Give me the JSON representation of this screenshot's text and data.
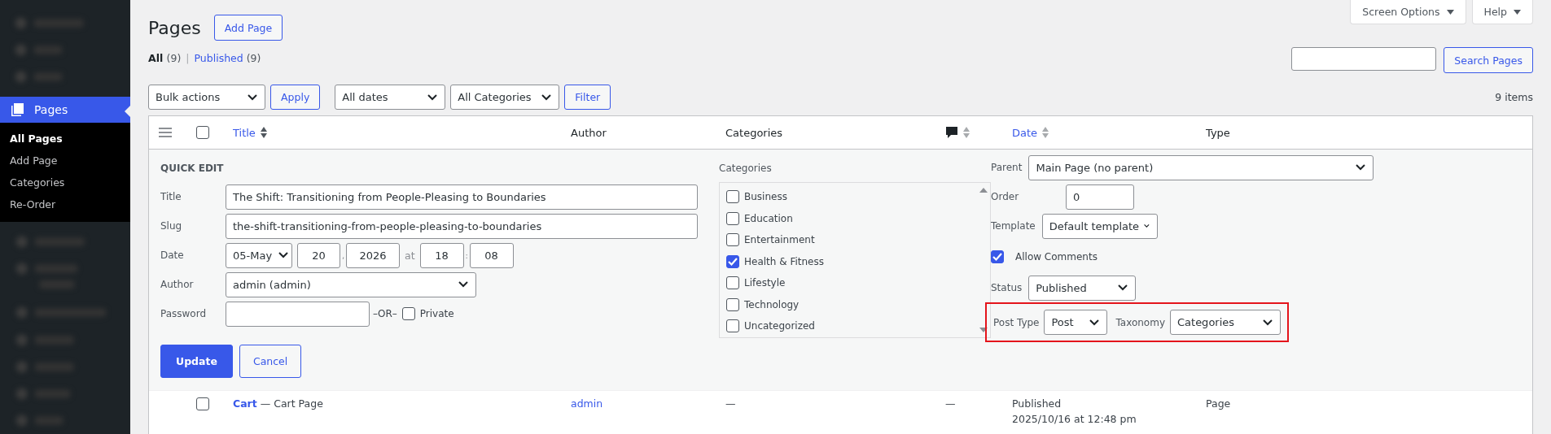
{
  "sidebar": {
    "active": {
      "label": "Pages",
      "selected": true
    },
    "submenu": [
      {
        "label": "All Pages",
        "selected": true
      },
      {
        "label": "Add Page",
        "selected": false
      },
      {
        "label": "Categories",
        "selected": false
      },
      {
        "label": "Re-Order",
        "selected": false
      }
    ]
  },
  "header": {
    "title": "Pages",
    "add_button": "Add Page",
    "screen_options": "Screen Options",
    "help": "Help"
  },
  "views_separator": "|",
  "views": [
    {
      "label": "All",
      "count": "(9)",
      "selected": true
    },
    {
      "label": "Published",
      "count": "(9)",
      "selected": false
    }
  ],
  "search": {
    "button": "Search Pages"
  },
  "toolbar": {
    "bulk_actions": "Bulk actions",
    "apply": "Apply",
    "dates": "All dates",
    "categories": "All Categories",
    "filter": "Filter",
    "items_count": "9 items"
  },
  "table": {
    "select_all": {
      "checked": false
    },
    "columns": [
      {
        "kind": "text",
        "label": "Title",
        "sortable": true
      },
      {
        "kind": "text",
        "label": "Author",
        "sortable": false
      },
      {
        "kind": "text",
        "label": "Categories",
        "sortable": false
      },
      {
        "kind": "comments",
        "sortable": true
      },
      {
        "kind": "text",
        "label": "Date",
        "sortable": true
      },
      {
        "kind": "text",
        "label": "Type",
        "sortable": false
      }
    ],
    "quick_edit": {
      "heading": "QUICK EDIT",
      "title": {
        "label": "Title",
        "value": "The Shift: Transitioning from People-Pleasing to Boundaries"
      },
      "slug": {
        "label": "Slug",
        "value": "the-shift-transitioning-from-people-pleasing-to-boundaries"
      },
      "date": {
        "label": "Date",
        "month": "05-May",
        "day": "20",
        "sep1": ",",
        "year": "2026",
        "at": "at",
        "hour": "18",
        "sep2": ":",
        "minute": "08"
      },
      "author": {
        "label": "Author",
        "value": "admin (admin)"
      },
      "password": {
        "label": "Password",
        "or": "–OR–",
        "private": {
          "label": "Private",
          "checked": false
        }
      },
      "categories_label": "Categories",
      "categories": [
        {
          "label": "Business",
          "checked": false
        },
        {
          "label": "Education",
          "checked": false
        },
        {
          "label": "Entertainment",
          "checked": false
        },
        {
          "label": "Health & Fitness",
          "checked": true
        },
        {
          "label": "Lifestyle",
          "checked": false
        },
        {
          "label": "Technology",
          "checked": false
        },
        {
          "label": "Uncategorized",
          "checked": false
        }
      ],
      "parent": {
        "label": "Parent",
        "value": "Main Page (no parent)"
      },
      "order": {
        "label": "Order",
        "value": "0"
      },
      "template": {
        "label": "Template",
        "value": "Default template"
      },
      "allow_comments": {
        "label": "Allow Comments",
        "checked": true
      },
      "status": {
        "label": "Status",
        "value": "Published"
      },
      "post_type": {
        "label": "Post Type",
        "value": "Post"
      },
      "taxonomy": {
        "label": "Taxonomy",
        "value": "Categories"
      },
      "update_button": "Update",
      "cancel_button": "Cancel"
    },
    "rows": [
      {
        "checked": false,
        "title": "Cart",
        "suffix": "— Cart Page",
        "author": "admin",
        "categories": "—",
        "comments": "—",
        "status": "Published",
        "date": "2025/10/16 at 12:48 pm",
        "type": "Page"
      }
    ]
  }
}
